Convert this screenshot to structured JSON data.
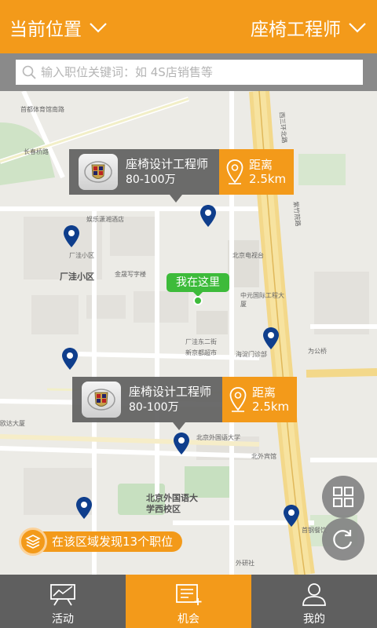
{
  "header": {
    "location_label": "当前位置",
    "job_filter_label": "座椅工程师"
  },
  "search": {
    "placeholder": "输入职位关键词：如 4S店销售等"
  },
  "map": {
    "district_labels": [
      "厂洼小区",
      "北京外国语大学西校区"
    ],
    "street_labels": [
      "首都体育馆南路",
      "厂洼东二街",
      "西三环北路",
      "紫竹院路",
      "北京电视台",
      "中元国际工程大厦",
      "新京都超市",
      "北京外国语大学",
      "北外宾馆",
      "首钢餐饮",
      "外研社",
      "为公桥",
      "欧达大厦",
      "长春桥路",
      "娱乐潇湘酒店",
      "厂洼小区",
      "金晟写字楼",
      "海淀门诊部"
    ]
  },
  "job_cards": [
    {
      "title": "座椅设计工程师",
      "salary": "80-100万",
      "distance_label": "距离",
      "distance": "2.5km"
    },
    {
      "title": "座椅设计工程师",
      "salary": "80-100万",
      "distance_label": "距离",
      "distance": "2.5km"
    }
  ],
  "here_label": "我在这里",
  "found_text": "在该区域发现13个职位",
  "tabs": [
    {
      "label": "活动",
      "icon": "easel-icon",
      "active": false
    },
    {
      "label": "机会",
      "icon": "list-add-icon",
      "active": true
    },
    {
      "label": "我的",
      "icon": "person-icon",
      "active": false
    }
  ],
  "colors": {
    "accent": "#f39a1a",
    "tabbar": "#5f5f5f",
    "pin": "#0f3e8c",
    "here": "#3dbb3a"
  }
}
